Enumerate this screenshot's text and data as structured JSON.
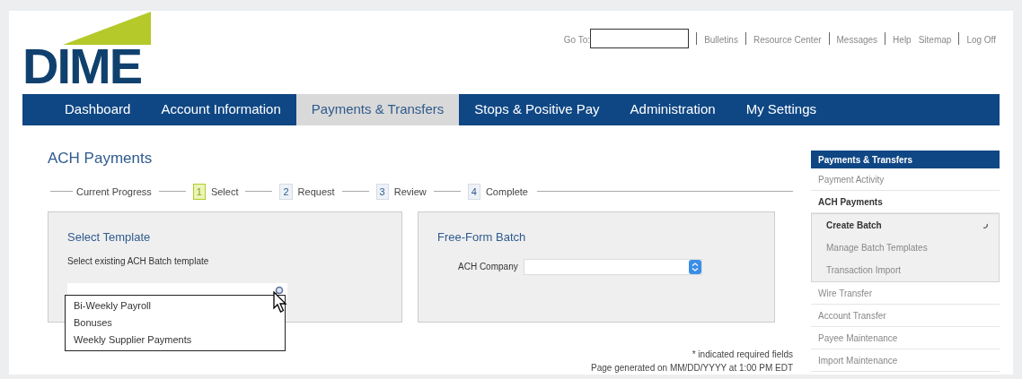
{
  "logo": {
    "text": "DIME"
  },
  "top_links": {
    "goto_label": "Go To:",
    "links": [
      "Bulletins",
      "Resource Center",
      "Messages",
      "Help",
      "Sitemap",
      "Log Off"
    ]
  },
  "nav": [
    {
      "label": "Dashboard",
      "selected": false
    },
    {
      "label": "Account Information",
      "selected": false
    },
    {
      "label": "Payments & Transfers",
      "selected": true
    },
    {
      "label": "Stops & Positive Pay",
      "selected": false
    },
    {
      "label": "Administration",
      "selected": false
    },
    {
      "label": "My Settings",
      "selected": false
    }
  ],
  "page_title": "ACH Payments",
  "progress": {
    "label": "Current Progress",
    "steps": [
      {
        "number": "1",
        "label": "Select",
        "selected": true
      },
      {
        "number": "2",
        "label": "Request",
        "selected": false
      },
      {
        "number": "3",
        "label": "Review",
        "selected": false
      },
      {
        "number": "4",
        "label": "Complete",
        "selected": false
      }
    ]
  },
  "select_template": {
    "title": "Select Template",
    "description": "Select existing ACH Batch template",
    "options": [
      "Bi-Weekly Payroll",
      "Bonuses",
      "Weekly Supplier Payments"
    ]
  },
  "free_form": {
    "title": "Free-Form Batch",
    "field_label": "ACH Company"
  },
  "footer": {
    "required_note": "* indicated required fields",
    "generated": "Page generated on MM/DD/YYYY at 1:00 PM EDT"
  },
  "sidebar": {
    "title": "Payments & Transfers",
    "items": [
      {
        "label": "Payment Activity",
        "selected": false
      },
      {
        "label": "ACH Payments",
        "selected": false,
        "expanded": true,
        "children": [
          {
            "label": "Create Batch",
            "selected": true
          },
          {
            "label": "Manage Batch Templates",
            "selected": false
          },
          {
            "label": "Transaction Import",
            "selected": false
          }
        ]
      },
      {
        "label": "Wire Transfer",
        "selected": false
      },
      {
        "label": "Account Transfer",
        "selected": false
      },
      {
        "label": "Payee Maintenance",
        "selected": false
      },
      {
        "label": "Import Maintenance",
        "selected": false
      }
    ]
  }
}
